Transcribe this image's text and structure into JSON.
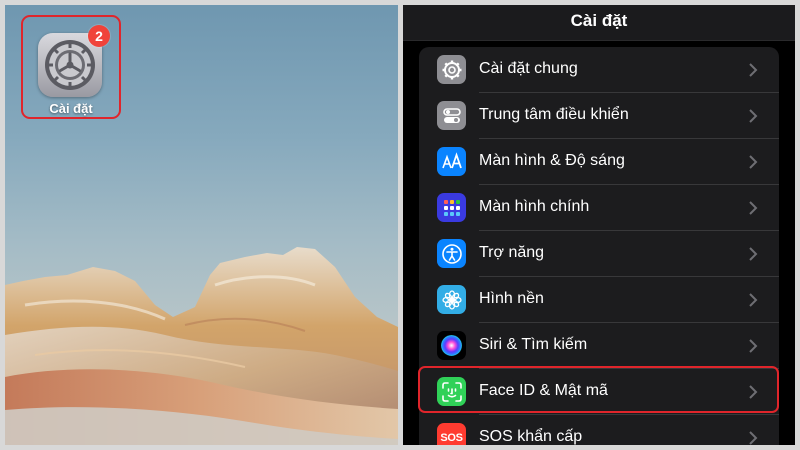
{
  "home": {
    "app_label": "Cài đặt",
    "badge_count": "2",
    "icon": "settings-gear-icon",
    "highlight_color": "#e0252b"
  },
  "settings": {
    "title": "Cài đặt",
    "items": [
      {
        "label": "Cài đặt chung",
        "icon": "gear-icon",
        "color": "#8e8e93"
      },
      {
        "label": "Trung tâm điều khiển",
        "icon": "toggles-icon",
        "color": "#8e8e93"
      },
      {
        "label": "Màn hình & Độ sáng",
        "icon": "text-size-icon",
        "color": "#0a84ff"
      },
      {
        "label": "Màn hình chính",
        "icon": "app-grid-icon",
        "color": "#3a3ae0"
      },
      {
        "label": "Trợ năng",
        "icon": "accessibility-icon",
        "color": "#0a84ff"
      },
      {
        "label": "Hình nền",
        "icon": "flower-icon",
        "color": "#32ade6"
      },
      {
        "label": "Siri & Tìm kiếm",
        "icon": "siri-icon",
        "color": "#1c1c1e"
      },
      {
        "label": "Face ID & Mật mã",
        "icon": "face-id-icon",
        "color": "#30d158"
      },
      {
        "label": "SOS khẩn cấp",
        "icon": "sos-icon",
        "color": "#ff3b30",
        "icon_text": "SOS"
      }
    ]
  }
}
